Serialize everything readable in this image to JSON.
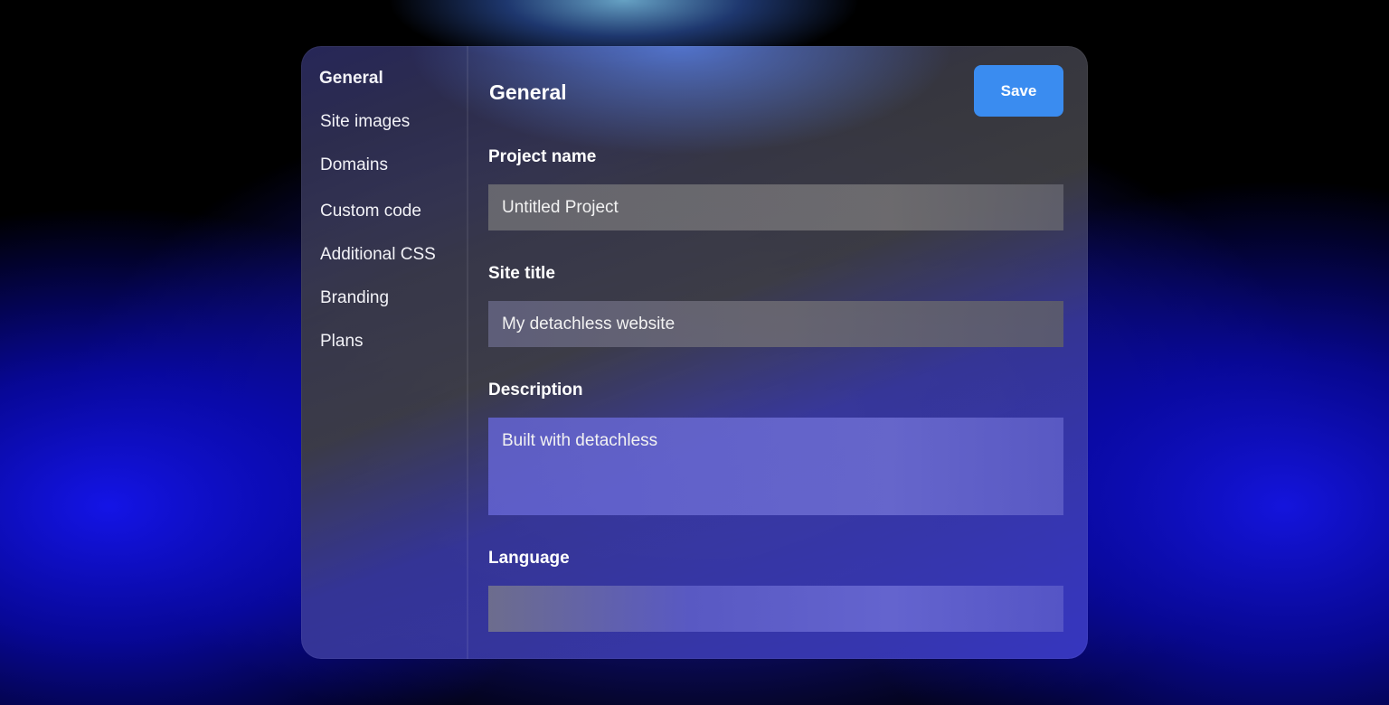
{
  "sidebar": {
    "items": [
      {
        "label": "General",
        "active": true
      },
      {
        "label": "Site images",
        "active": false
      },
      {
        "label": "Domains",
        "active": false
      },
      {
        "label": "Custom code",
        "active": false
      },
      {
        "label": "Additional CSS",
        "active": false
      },
      {
        "label": "Branding",
        "active": false
      },
      {
        "label": "Plans",
        "active": false
      }
    ]
  },
  "main": {
    "title": "General",
    "save_label": "Save",
    "fields": {
      "project_name": {
        "label": "Project name",
        "value": "Untitled Project"
      },
      "site_title": {
        "label": "Site title",
        "value": "My detachless website"
      },
      "description": {
        "label": "Description",
        "value": "Built with detachless"
      },
      "language": {
        "label": "Language",
        "value": ""
      }
    }
  },
  "colors": {
    "accent": "#3a8cf0",
    "text": "#ffffff"
  }
}
